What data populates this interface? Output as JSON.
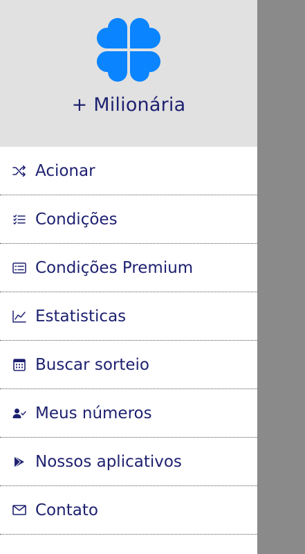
{
  "colors": {
    "brand_blue": "#0a84ff",
    "text_navy": "#1e2170",
    "header_bg": "#e1e1e1",
    "scrim": "#8a8a8a"
  },
  "header": {
    "logo_icon": "clover-icon",
    "title": "+ Milionária"
  },
  "menu": {
    "items": [
      {
        "label": "Acionar",
        "icon": "shuffle-icon"
      },
      {
        "label": "Condições",
        "icon": "checklist-icon"
      },
      {
        "label": "Condições Premium",
        "icon": "list-card-icon"
      },
      {
        "label": "Estatisticas",
        "icon": "line-chart-icon"
      },
      {
        "label": "Buscar sorteio",
        "icon": "calendar-icon"
      },
      {
        "label": "Meus números",
        "icon": "user-check-icon"
      },
      {
        "label": "Nossos aplicativos",
        "icon": "play-store-icon"
      },
      {
        "label": "Contato",
        "icon": "mail-icon"
      }
    ]
  }
}
